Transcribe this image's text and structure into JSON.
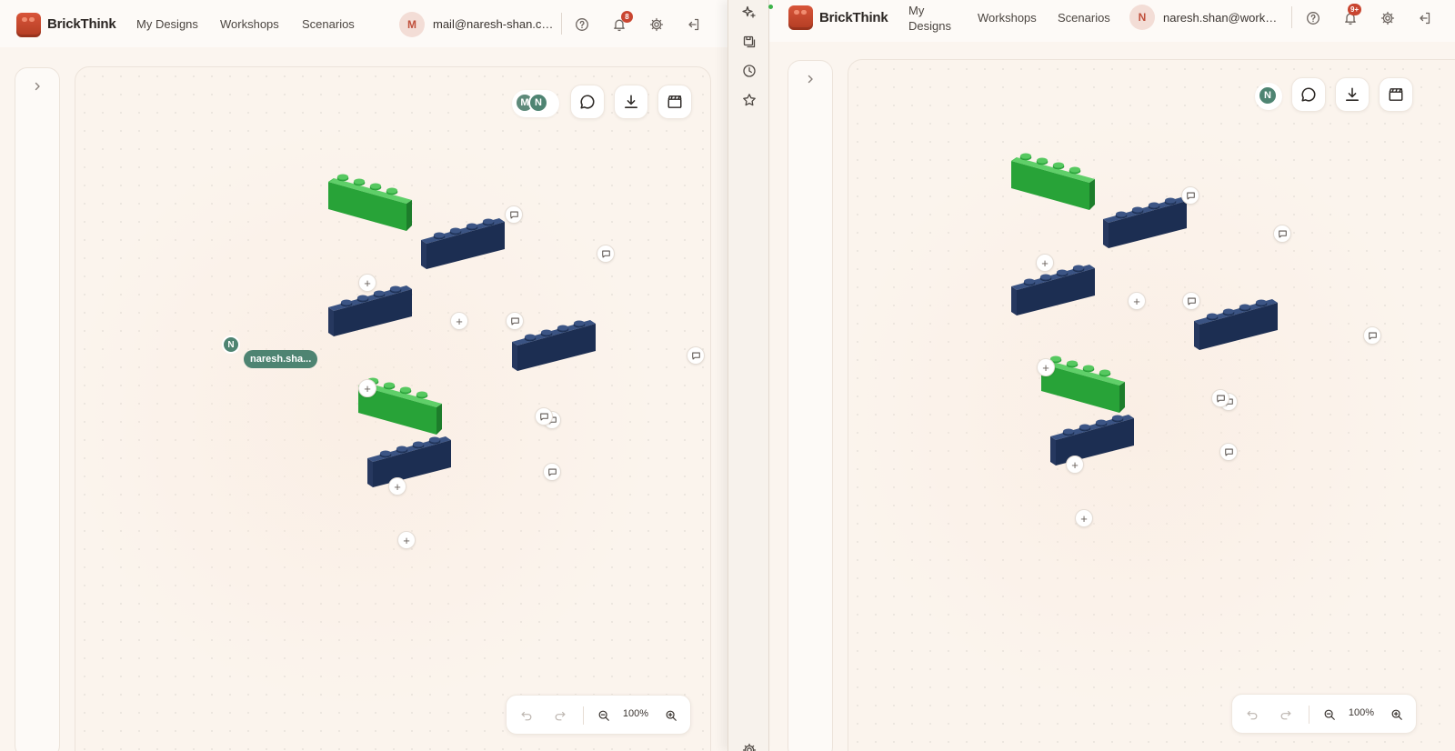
{
  "left_window": {
    "brand": "BrickThink",
    "nav": [
      "My Designs",
      "Workshops",
      "Scenarios"
    ],
    "user_initial": "M",
    "user_email": "mail@naresh-shan.com",
    "notification_count": "8",
    "presence_initials": [
      "M",
      "N"
    ],
    "remote_cursor": {
      "initial": "N",
      "label": "naresh.sha..."
    },
    "zoom": "100%"
  },
  "right_window": {
    "brand": "BrickThink",
    "nav": [
      "My\nDesigns",
      "Workshops",
      "Scenarios"
    ],
    "user_initial": "N",
    "user_email": "naresh.shan@workpa...",
    "notification_count": "9+",
    "presence_initials": [
      "N"
    ],
    "zoom": "100%"
  },
  "icons": {
    "help": "help-circle-icon",
    "notifications": "bell-icon",
    "settings": "gear-icon",
    "logout": "logout-icon",
    "comments": "comment-icon",
    "download": "download-icon",
    "scenes": "clapperboard-icon",
    "undo": "undo-icon",
    "redo": "redo-icon",
    "zoom_out": "zoom-out-icon",
    "zoom_in": "zoom-in-icon",
    "sidebar_toggle": "chevron-right-icon",
    "strip": [
      "sparkles-icon",
      "save-icon",
      "history-icon",
      "star-icon",
      "gear-icon"
    ]
  },
  "colors": {
    "brand": "#c9452b",
    "brick_green": "#2eaa3c",
    "brick_navy": "#1e3358",
    "collaborator": "#4e8472",
    "canvas_bg": "#fbf4ed"
  }
}
